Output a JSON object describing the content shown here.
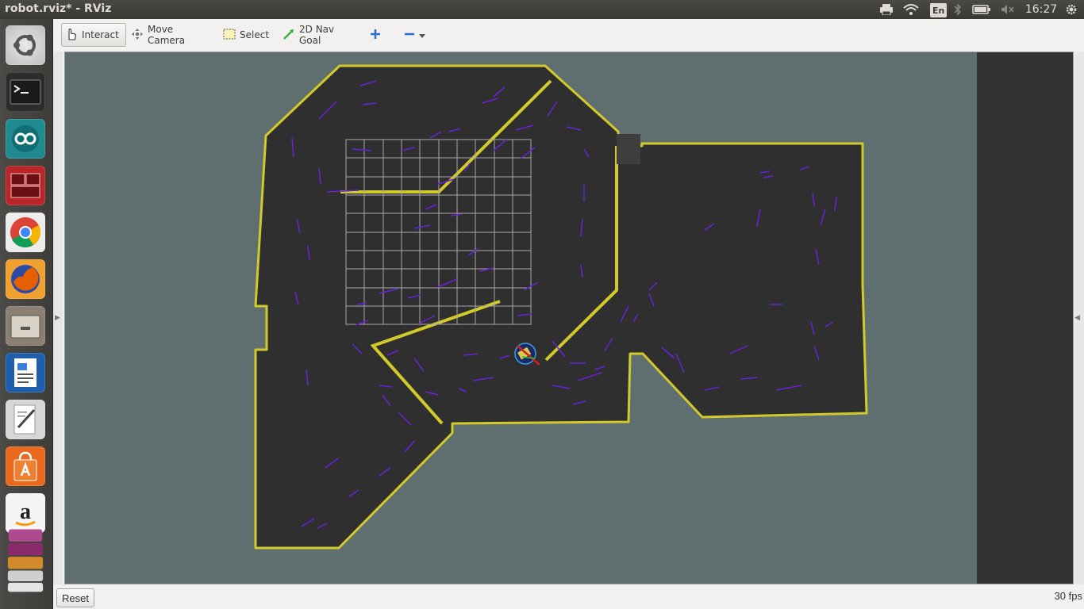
{
  "window": {
    "title": "robot.rviz* - RViz"
  },
  "top_panel": {
    "language": "En",
    "clock": "16:27"
  },
  "launcher": {
    "items": [
      {
        "name": "ubuntu-dash-icon"
      },
      {
        "name": "terminal-icon"
      },
      {
        "name": "arduino-icon"
      },
      {
        "name": "terminator-icon"
      },
      {
        "name": "chrome-icon"
      },
      {
        "name": "firefox-icon"
      },
      {
        "name": "files-icon"
      },
      {
        "name": "writer-icon"
      },
      {
        "name": "text-editor-icon"
      },
      {
        "name": "software-center-icon"
      },
      {
        "name": "amazon-icon"
      },
      {
        "name": "stacked-apps-icon"
      }
    ]
  },
  "toolbar": {
    "interact": "Interact",
    "move_camera": "Move Camera",
    "select": "Select",
    "nav_goal": "2D Nav Goal"
  },
  "status": {
    "reset": "Reset",
    "fps": "30 fps"
  },
  "colors": {
    "background": "#5f6f70",
    "map_free": "#2f2f2f",
    "map_walls": "#d2c92a",
    "particles": "#6a22d8",
    "grid": "#a8a8a8"
  }
}
